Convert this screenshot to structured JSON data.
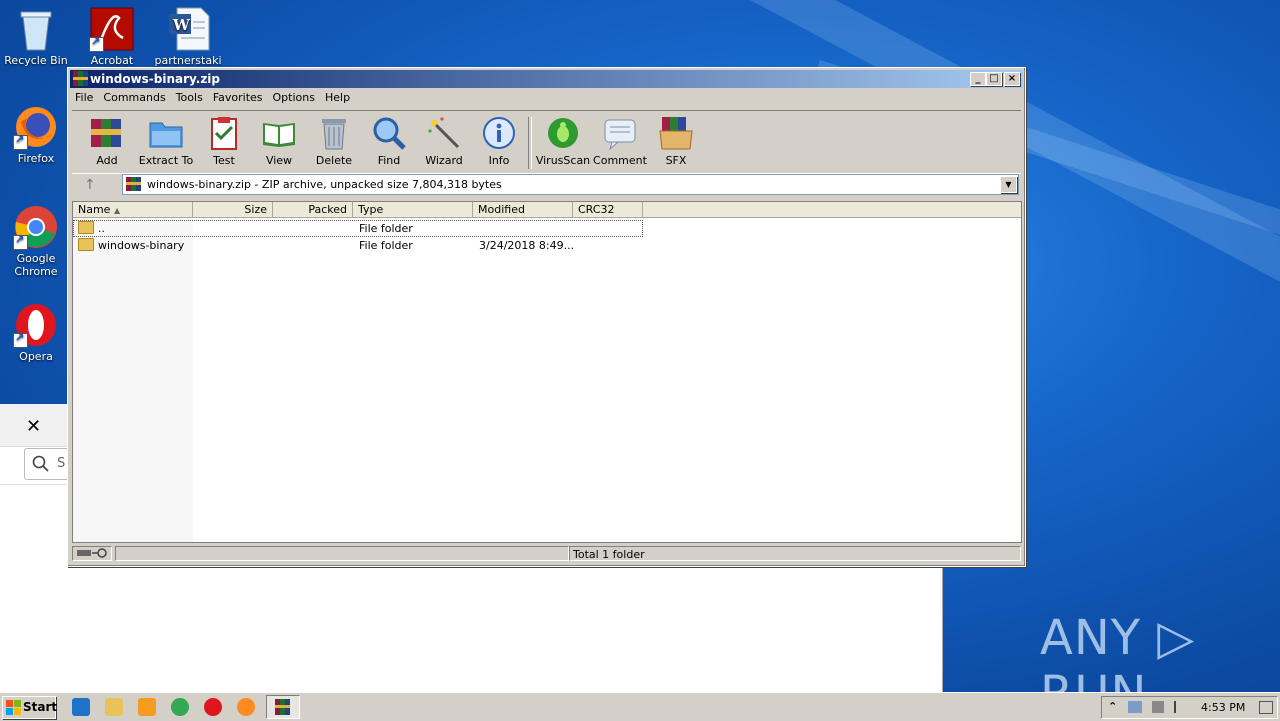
{
  "desktop": {
    "icons": [
      {
        "label": "Recycle Bin"
      },
      {
        "label": "Acrobat"
      },
      {
        "label": "partnerstaki"
      },
      {
        "label": "Firefox"
      },
      {
        "label": "Google Chrome"
      },
      {
        "label": "Opera"
      }
    ],
    "watermark": "ANY ▷ RUN"
  },
  "bg_window": {
    "close_glyph": "✕",
    "search_placeholder": "S"
  },
  "window": {
    "title": "windows-binary.zip",
    "controls": {
      "minimize": "_",
      "maximize": "□",
      "close": "×"
    }
  },
  "menu": [
    "File",
    "Commands",
    "Tools",
    "Favorites",
    "Options",
    "Help"
  ],
  "toolbar": [
    {
      "label": "Add",
      "icon": "rar-books-icon"
    },
    {
      "label": "Extract To",
      "icon": "folder-extract-icon"
    },
    {
      "label": "Test",
      "icon": "clipboard-check-icon"
    },
    {
      "label": "View",
      "icon": "book-view-icon"
    },
    {
      "label": "Delete",
      "icon": "trash-icon"
    },
    {
      "label": "Find",
      "icon": "magnifier-icon"
    },
    {
      "label": "Wizard",
      "icon": "magic-wand-icon"
    },
    {
      "label": "Info",
      "icon": "info-icon"
    },
    {
      "label": "VirusScan",
      "icon": "bug-icon"
    },
    {
      "label": "Comment",
      "icon": "comment-icon"
    },
    {
      "label": "SFX",
      "icon": "sfx-box-icon"
    }
  ],
  "address": {
    "text": "windows-binary.zip - ZIP archive, unpacked size 7,804,318 bytes"
  },
  "columns": [
    "Name",
    "Size",
    "Packed",
    "Type",
    "Modified",
    "CRC32"
  ],
  "rows": [
    {
      "name": "..",
      "size": "",
      "packed": "",
      "type": "File folder",
      "modified": "",
      "crc": ""
    },
    {
      "name": "windows-binary",
      "size": "",
      "packed": "",
      "type": "File folder",
      "modified": "3/24/2018 8:49...",
      "crc": ""
    }
  ],
  "status": {
    "summary": "Total 1 folder"
  },
  "taskbar": {
    "start_label": "Start",
    "clock": "4:53 PM",
    "tray_chevron": "⌃"
  }
}
